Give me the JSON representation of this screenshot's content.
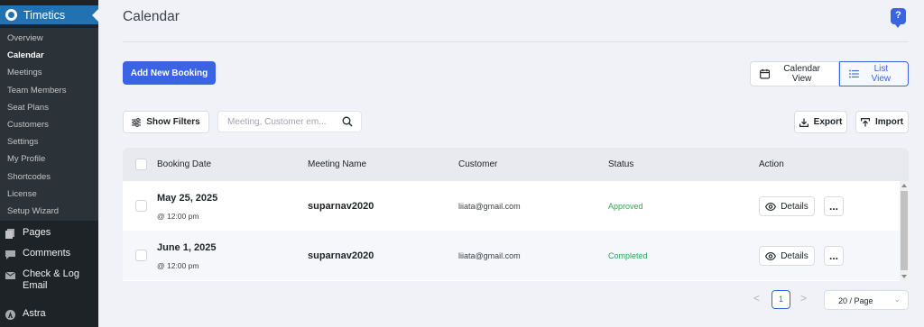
{
  "sidebar": {
    "plugin_name": "Timetics",
    "submenu": [
      {
        "label": "Overview",
        "current": false
      },
      {
        "label": "Calendar",
        "current": true
      },
      {
        "label": "Meetings",
        "current": false
      },
      {
        "label": "Team Members",
        "current": false
      },
      {
        "label": "Seat Plans",
        "current": false
      },
      {
        "label": "Customers",
        "current": false
      },
      {
        "label": "Settings",
        "current": false
      },
      {
        "label": "My Profile",
        "current": false
      },
      {
        "label": "Shortcodes",
        "current": false
      },
      {
        "label": "License",
        "current": false
      },
      {
        "label": "Setup Wizard",
        "current": false
      }
    ],
    "menu": [
      {
        "label": "Pages",
        "icon": "pages-icon"
      },
      {
        "label": "Comments",
        "icon": "comments-icon"
      },
      {
        "label": "Check & Log Email",
        "icon": "email-icon"
      },
      {
        "label": "Astra",
        "icon": "astra-icon"
      }
    ]
  },
  "header": {
    "title": "Calendar",
    "help_label": "?"
  },
  "toolbar": {
    "add_booking": "Add New Booking",
    "calendar_view": "Calendar View",
    "list_view": "List View",
    "show_filters": "Show Filters",
    "search_placeholder": "Meeting, Customer em...",
    "export": "Export",
    "import": "Import"
  },
  "table": {
    "columns": [
      "Booking Date",
      "Meeting Name",
      "Customer",
      "Status",
      "Action"
    ],
    "rows": [
      {
        "date": "May 25, 2025",
        "time": "@ 12:00 pm",
        "meeting": "suparnav2020",
        "customer": "liiata@gmail.com",
        "status": "Approved",
        "details": "Details",
        "more": "..."
      },
      {
        "date": "June 1, 2025",
        "time": "@ 12:00 pm",
        "meeting": "suparnav2020",
        "customer": "liiata@gmail.com",
        "status": "Completed",
        "details": "Details",
        "more": "..."
      }
    ]
  },
  "pagination": {
    "current_page": "1",
    "page_size": "20 / Page",
    "prev": "<",
    "next": ">"
  },
  "colors": {
    "primary": "#3b64e4",
    "sidebar_bg": "#1d2327",
    "status_green": "#2ea44f"
  }
}
